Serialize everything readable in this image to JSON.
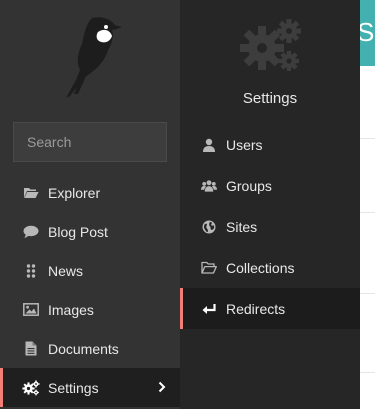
{
  "search": {
    "placeholder": "Search"
  },
  "menu": {
    "items": [
      {
        "label": "Explorer",
        "icon": "folder-open-icon"
      },
      {
        "label": "Blog Post",
        "icon": "speech-bubble-icon"
      },
      {
        "label": "News",
        "icon": "drag-dots-icon"
      },
      {
        "label": "Images",
        "icon": "image-icon"
      },
      {
        "label": "Documents",
        "icon": "document-icon"
      },
      {
        "label": "Settings",
        "icon": "cogs-icon",
        "active": true
      }
    ]
  },
  "submenu": {
    "title": "Settings",
    "items": [
      {
        "label": "Users",
        "icon": "user-icon"
      },
      {
        "label": "Groups",
        "icon": "group-icon"
      },
      {
        "label": "Sites",
        "icon": "globe-icon"
      },
      {
        "label": "Collections",
        "icon": "folder-outline-icon"
      },
      {
        "label": "Redirects",
        "icon": "redirect-arrow-icon",
        "active": true
      }
    ]
  },
  "page": {
    "header_letter": "S"
  },
  "colors": {
    "accent": "#f37e77",
    "teal": "#43b1b0",
    "sidebar": "#333333",
    "submenu": "#262626"
  }
}
